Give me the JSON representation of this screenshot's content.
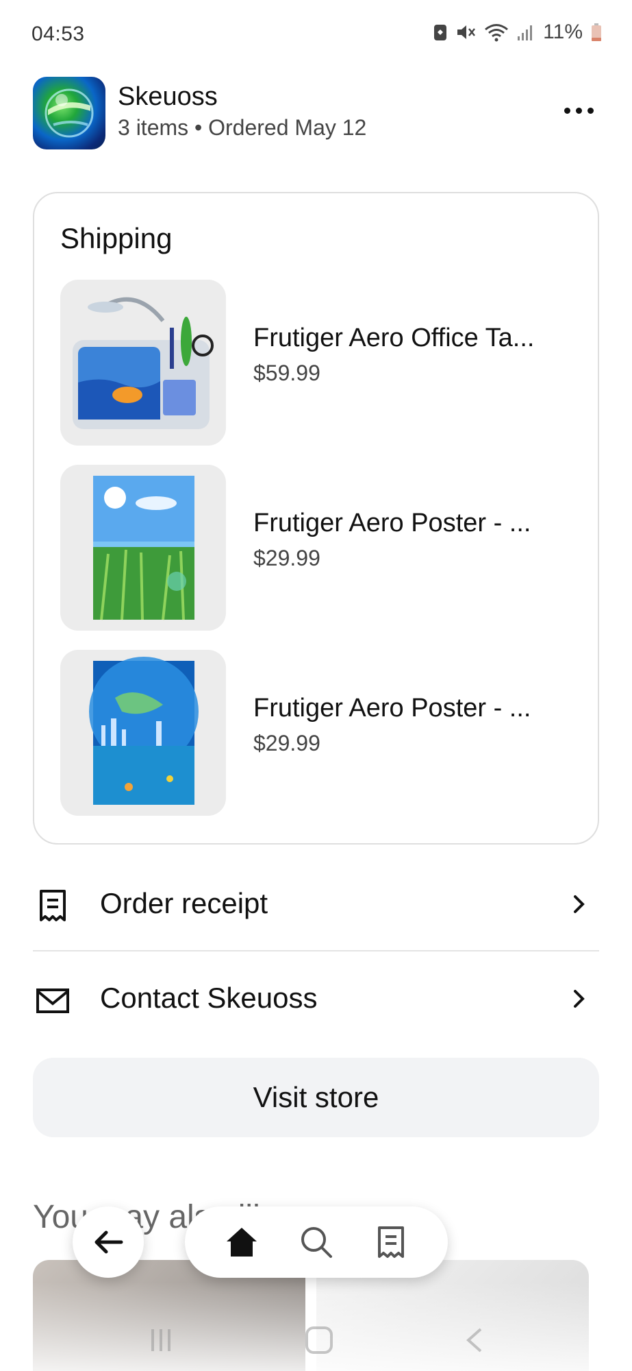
{
  "status_bar": {
    "time": "04:53",
    "battery": "11%",
    "icons": [
      "sim-icon",
      "mute-icon",
      "wifi-icon",
      "signal-icon",
      "battery-icon"
    ]
  },
  "header": {
    "shop_name": "Skeuoss",
    "meta": "3 items • Ordered May 12",
    "more_icon": "more-horizontal-icon"
  },
  "shipping": {
    "title": "Shipping",
    "items": [
      {
        "name": "Frutiger Aero Office Ta...",
        "price": "$59.99"
      },
      {
        "name": "Frutiger Aero Poster - ...",
        "price": "$29.99"
      },
      {
        "name": "Frutiger Aero Poster - ...",
        "price": "$29.99"
      }
    ]
  },
  "actions": {
    "order_receipt": "Order receipt",
    "contact": "Contact Skeuoss",
    "visit_store": "Visit store"
  },
  "recommendations": {
    "title": "You may also like"
  },
  "nav": {
    "icons": [
      "back-arrow-icon",
      "home-icon",
      "search-icon",
      "receipt-icon"
    ]
  },
  "colors": {
    "accent": "#111111",
    "button_bg": "#f2f3f5",
    "card_border": "#dedede"
  }
}
